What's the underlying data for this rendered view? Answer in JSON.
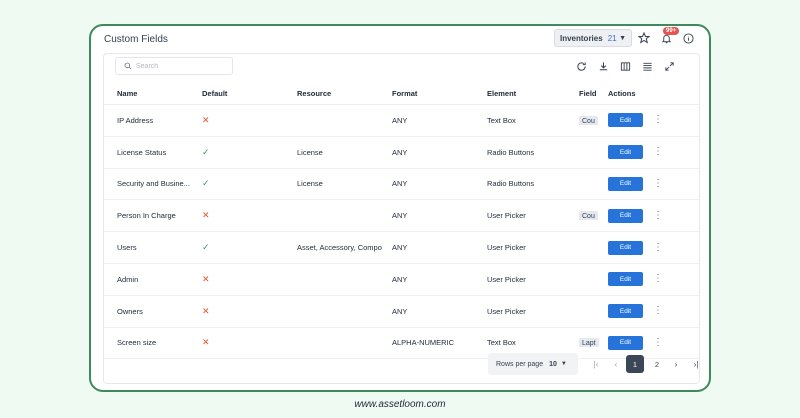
{
  "header": {
    "title": "Custom Fields",
    "inventory_label": "Inventories",
    "inventory_count": "21",
    "notification_badge": "99+"
  },
  "icons": {
    "star": "star-icon",
    "bell": "bell-icon",
    "info": "info-icon",
    "refresh": "refresh-icon",
    "download": "download-icon",
    "columns": "columns-icon",
    "density": "density-icon",
    "fullscreen": "fullscreen-icon"
  },
  "search": {
    "placeholder": "Search"
  },
  "table": {
    "columns": [
      "Name",
      "Default",
      "Resource",
      "Format",
      "Element",
      "Field",
      "Actions"
    ],
    "rows": [
      {
        "name": "IP Address",
        "default": "no",
        "resource": "",
        "format": "ANY",
        "element": "Text Box",
        "field": "Cou",
        "action": "Edit"
      },
      {
        "name": "License Status",
        "default": "yes",
        "resource": "License",
        "format": "ANY",
        "element": "Radio Buttons",
        "field": "",
        "action": "Edit"
      },
      {
        "name": "Security and Busine...",
        "default": "yes",
        "resource": "License",
        "format": "ANY",
        "element": "Radio Buttons",
        "field": "",
        "action": "Edit"
      },
      {
        "name": "Person In Charge",
        "default": "no",
        "resource": "",
        "format": "ANY",
        "element": "User Picker",
        "field": "Cou",
        "action": "Edit"
      },
      {
        "name": "Users",
        "default": "yes",
        "resource": "Asset, Accessory, Compo",
        "format": "ANY",
        "element": "User Picker",
        "field": "",
        "action": "Edit"
      },
      {
        "name": "Admin",
        "default": "no",
        "resource": "",
        "format": "ANY",
        "element": "User Picker",
        "field": "",
        "action": "Edit"
      },
      {
        "name": "Owners",
        "default": "no",
        "resource": "",
        "format": "ANY",
        "element": "User Picker",
        "field": "",
        "action": "Edit"
      },
      {
        "name": "Screen size",
        "default": "no",
        "resource": "",
        "format": "ALPHA-NUMERIC",
        "element": "Text Box",
        "field": "Lapt",
        "action": "Edit"
      }
    ]
  },
  "pagination": {
    "rows_per_page_label": "Rows per page",
    "rows_per_page_value": "10",
    "pages": [
      "1",
      "2"
    ],
    "current_page": "1"
  },
  "footer": {
    "text": "www.assetloom.com"
  },
  "colors": {
    "accent": "#2674d9",
    "frame_border": "#3f8a5c",
    "background": "#eefaf2",
    "no_mark": "#e0562f",
    "yes_mark": "#2e9e57"
  }
}
